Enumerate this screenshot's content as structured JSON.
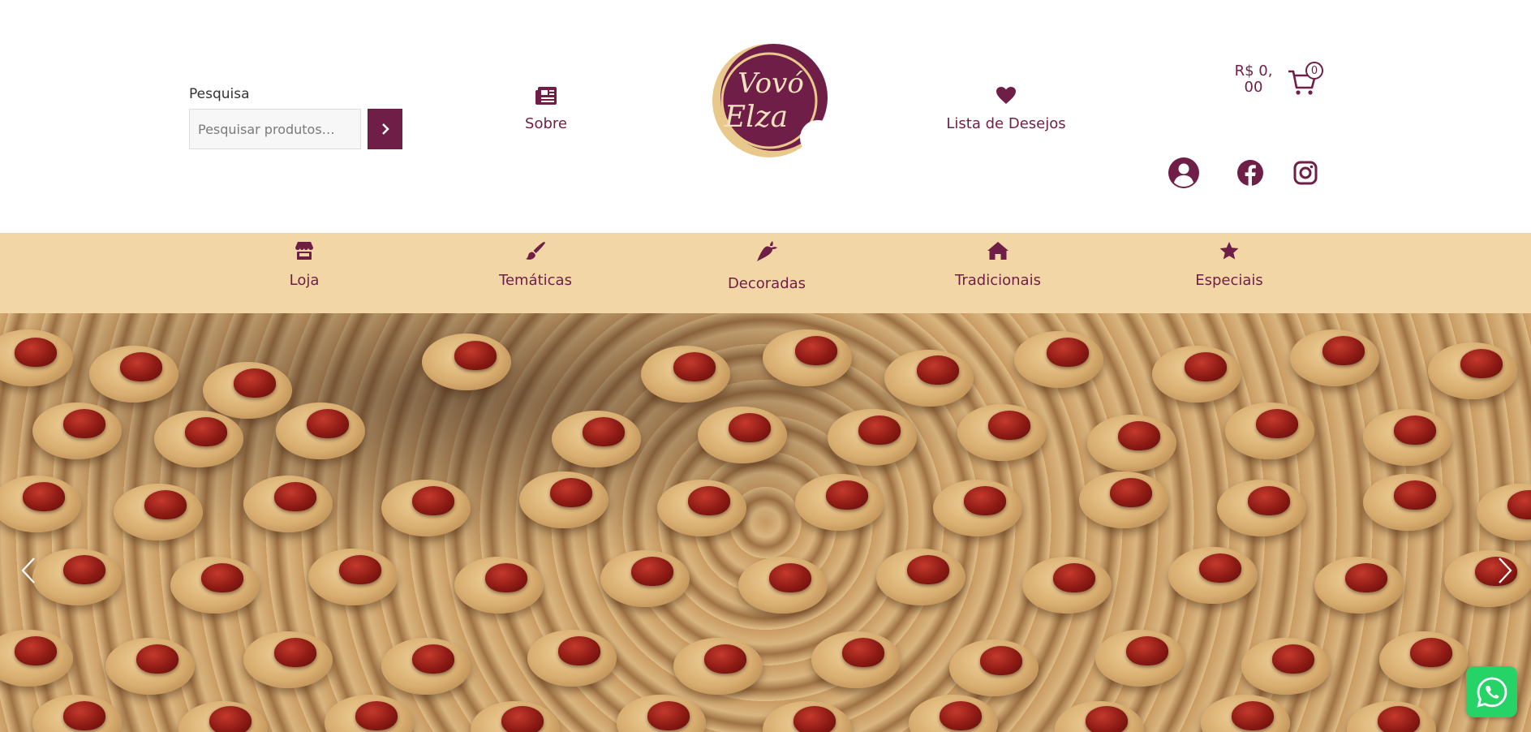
{
  "search": {
    "label": "Pesquisa",
    "placeholder": "Pesquisar produtos…"
  },
  "header": {
    "about_label": "Sobre",
    "wishlist_label": "Lista de Desejos",
    "logo_text_line1": "Vovó",
    "logo_text_line2": "Elza"
  },
  "cart": {
    "amount": "R$ 0,\n00",
    "count": "0"
  },
  "nav": {
    "items": [
      {
        "label": "Loja",
        "icon": "store-icon"
      },
      {
        "label": "Temáticas",
        "icon": "brush-icon"
      },
      {
        "label": "Decoradas",
        "icon": "carrot-icon"
      },
      {
        "label": "Tradicionais",
        "icon": "home-icon"
      },
      {
        "label": "Especiais",
        "icon": "star-icon"
      }
    ]
  },
  "colors": {
    "brand": "#6f1f47",
    "nav_bg": "#f2d6a6",
    "logo_gold": "#e9c98b",
    "whatsapp": "#25d366"
  }
}
